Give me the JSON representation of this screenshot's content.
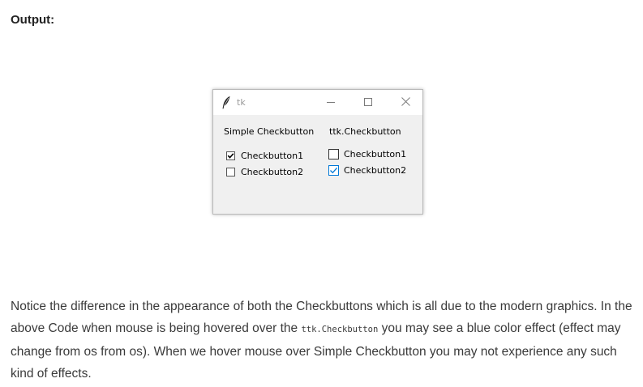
{
  "heading": "Output:",
  "window": {
    "title": "tk",
    "controls": {
      "minimize_icon": "minimize-icon",
      "maximize_icon": "maximize-icon",
      "close_icon": "close-icon"
    },
    "columns": {
      "simple_label": "Simple Checkbutton",
      "ttk_label": "ttk.Checkbutton"
    },
    "simple_checkbuttons": [
      {
        "label": "Checkbutton1",
        "checked": true
      },
      {
        "label": "Checkbutton2",
        "checked": false
      }
    ],
    "ttk_checkbuttons": [
      {
        "label": "Checkbutton1",
        "checked": false
      },
      {
        "label": "Checkbutton2",
        "checked": true
      }
    ],
    "colors": {
      "ttk_accent": "#0078d7",
      "window_bg": "#f0f0f0"
    }
  },
  "paragraph": {
    "part1": "Notice the difference in the appearance of both the Checkbuttons which is all due to the modern graphics. In the above Code when mouse is being hovered over the ",
    "code": "ttk.Checkbutton",
    "part2": " you may see a blue color effect (effect may change from os from os). When we hover mouse over Simple Checkbutton you may not experience any such kind of effects."
  }
}
